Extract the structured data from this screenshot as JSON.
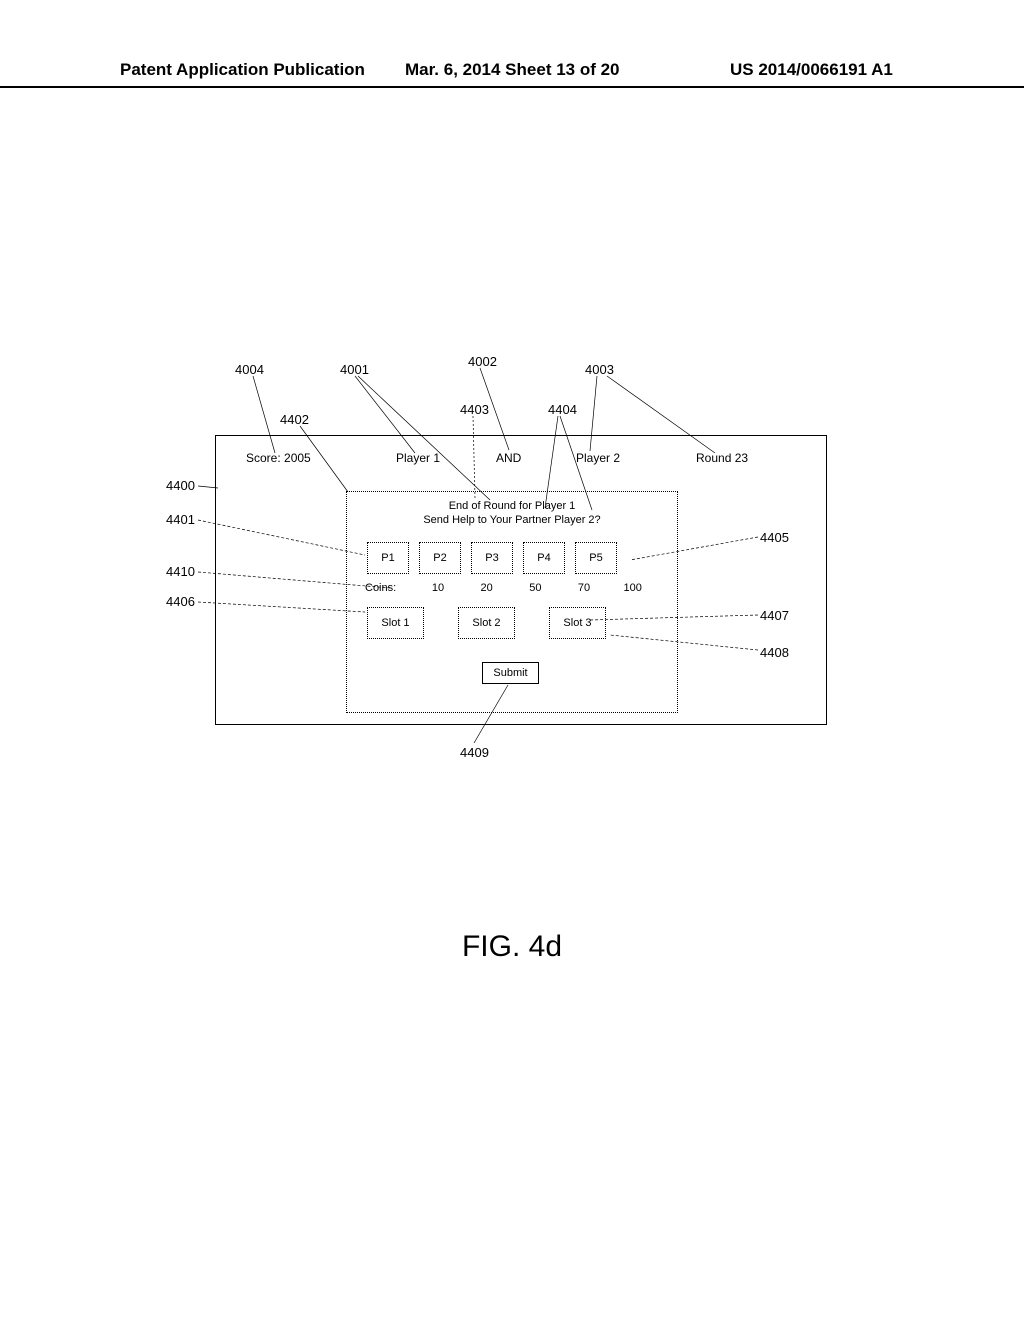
{
  "header": {
    "left": "Patent Application Publication",
    "mid": "Mar. 6, 2014  Sheet 13 of 20",
    "right": "US 2014/0066191 A1"
  },
  "figure_label": "FIG. 4d",
  "refs": {
    "r4004": "4004",
    "r4001": "4001",
    "r4002": "4002",
    "r4003": "4003",
    "r4402": "4402",
    "r4403": "4403",
    "r4404": "4404",
    "r4400": "4400",
    "r4401": "4401",
    "r4410": "4410",
    "r4406": "4406",
    "r4405": "4405",
    "r4407": "4407",
    "r4408": "4408",
    "r4409": "4409"
  },
  "status": {
    "score": "Score: 2005",
    "p1": "Player 1",
    "and": "AND",
    "p2": "Player 2",
    "round": "Round 23"
  },
  "inner": {
    "msg1": "End of Round for Player 1",
    "msg2": "Send Help to Your Partner Player 2?",
    "p": [
      "P1",
      "P2",
      "P3",
      "P4",
      "P5"
    ],
    "coins_label": "Coins:",
    "coins": [
      "10",
      "20",
      "50",
      "70",
      "100"
    ],
    "slots": [
      "Slot 1",
      "Slot 2",
      "Slot 3"
    ],
    "submit": "Submit"
  }
}
